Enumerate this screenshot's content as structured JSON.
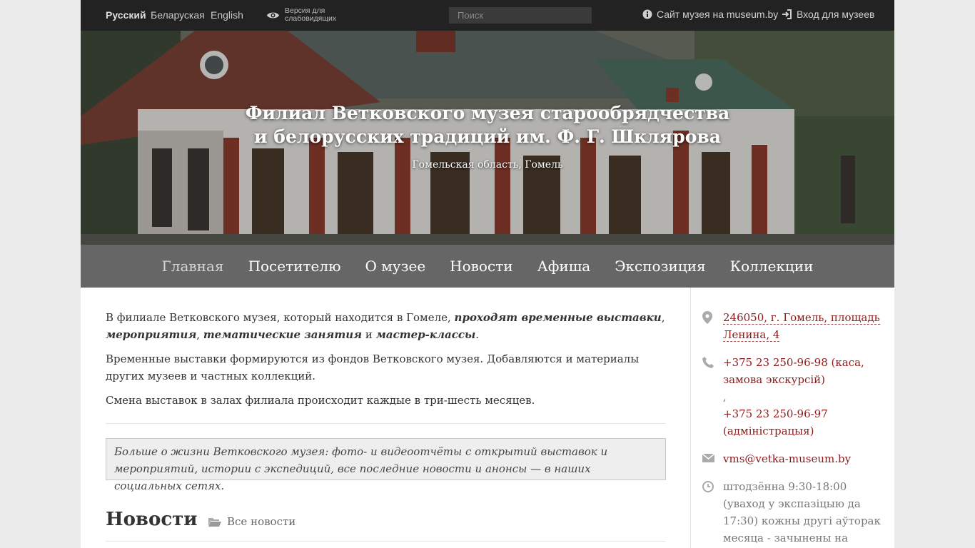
{
  "topbar": {
    "languages": [
      "Русский",
      "Беларуская",
      "English"
    ],
    "low_vision_label": "Версия для слабовидящих",
    "search_placeholder": "Поиск",
    "museum_site_link": "Сайт музея на museum.by",
    "login_link": "Вход для музеев"
  },
  "hero": {
    "title": "Филиал Ветковского музея старообрядчества и белорусских традиций им. Ф. Г. Шклярова",
    "subtitle": "Гомельская область, Гомель"
  },
  "nav": {
    "items": [
      "Главная",
      "Посетителю",
      "О музее",
      "Новости",
      "Афиша",
      "Экспозиция",
      "Коллекции"
    ]
  },
  "main": {
    "p1_start": "В филиале Ветковского музея, который находится в Гомеле, ",
    "p1_b1": "проходят временные выставки",
    "p1_sep1": ", ",
    "p1_b2": "мероприятия",
    "p1_sep2": ", ",
    "p1_b3": "тематические занятия",
    "p1_sep3": " и ",
    "p1_b4": "мастер-классы",
    "p1_end": ".",
    "p2": "Временные выставки формируются из фондов Ветковского музея. Добавляются и материалы других музеев и частных коллекций.",
    "p3": "Смена выставок в залах филиала происходит каждые в три-шесть месяцев.",
    "social_note": "Больше о жизни Ветковского музея: фото- и видеоотчёты с открытий выставок и мероприятий, истории с экспедиций, все последние новости и анонсы — в наших социальных сетях.",
    "news_heading": "Новости",
    "all_news_link": "Все новости"
  },
  "sidebar": {
    "address_line1": "246050, г. Гомель, площадь",
    "address_line2": "Ленина, 4",
    "phone1": "+375 23 250-96-98 (каса, замова экскурсій)",
    "phone_sep": ",",
    "phone2": "+375 23 250-96-97 (адміністрацыя)",
    "email": "vms@vetka-museum.by",
    "hours": "штодзённа 9:30-18:00 (уваход у экспазіцыю да 17:30) кожны другі аўторак месяца - зачынены на санітарны дзень"
  },
  "colors": {
    "accent_red": "#8a1c1c",
    "topbar_bg": "#222222",
    "nav_bg": "#666666"
  }
}
